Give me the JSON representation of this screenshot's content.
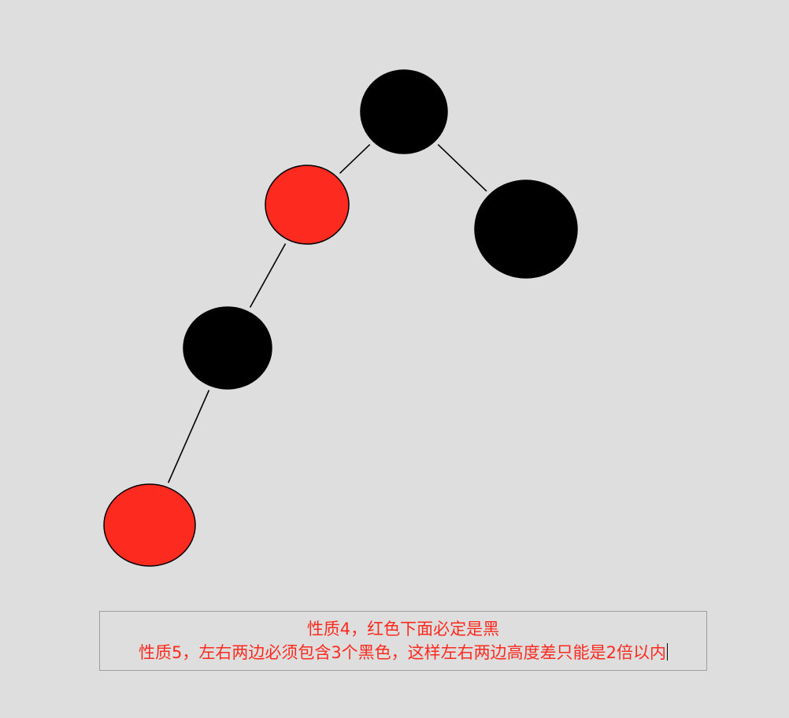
{
  "colors": {
    "background": "#dedede",
    "black_node": "#000000",
    "red_node": "#fd2b1f",
    "edge": "#000000",
    "note_text": "#fd2b1f",
    "note_border": "#9e9e9e"
  },
  "tree": {
    "nodes": [
      {
        "id": "root",
        "color": "black",
        "fill": "#000000"
      },
      {
        "id": "right-child",
        "color": "black",
        "fill": "#000000"
      },
      {
        "id": "left-child",
        "color": "red",
        "fill": "#fd2b1f"
      },
      {
        "id": "left-grandchild",
        "color": "black",
        "fill": "#000000"
      },
      {
        "id": "left-great-grandchild",
        "color": "red",
        "fill": "#fd2b1f"
      }
    ],
    "edges": [
      {
        "from": "root",
        "to": "left-child"
      },
      {
        "from": "root",
        "to": "right-child"
      },
      {
        "from": "left-child",
        "to": "left-grandchild"
      },
      {
        "from": "left-grandchild",
        "to": "left-great-grandchild"
      }
    ]
  },
  "note": {
    "line1": "性质4，红色下面必定是黑",
    "line2": "性质5，左右两边必须包含3个黑色，这样左右两边高度差只能是2倍以内"
  }
}
